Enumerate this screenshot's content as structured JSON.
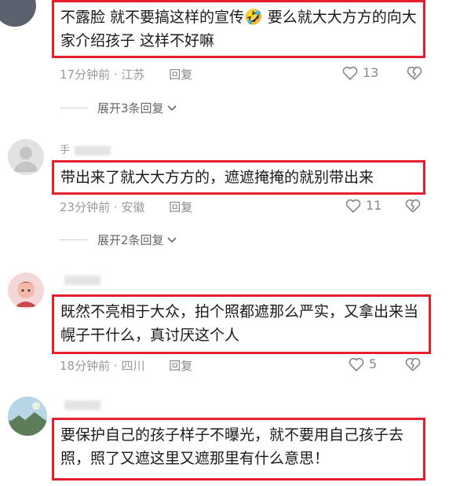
{
  "comments": [
    {
      "username": "",
      "text": "不露脸 就不要搞这样的宣传🤣 要么就大大方方的向大家介绍孩子 这样不好嘛",
      "time": "17分钟前",
      "location": "江苏",
      "reply_label": "回复",
      "likes": "13",
      "expand_label": "展开3条回复"
    },
    {
      "username": "手",
      "text": "带出来了就大大方方的，遮遮掩掩的就别带出来",
      "time": "23分钟前",
      "location": "安徽",
      "reply_label": "回复",
      "likes": "11",
      "expand_label": "展开2条回复"
    },
    {
      "username": "",
      "text": "既然不亮相于大众，拍个照都遮那么严实，又拿出来当幌子干什么，真讨厌这个人",
      "time": "18分钟前",
      "location": "四川",
      "reply_label": "回复",
      "likes": "5"
    },
    {
      "username": "",
      "text": "要保护自己的孩子样子不曝光，就不要用自己孩子去照，照了又遮这里又遮那里有什么意思！"
    }
  ],
  "meta_separator": "·",
  "colors": {
    "highlight_border": "#e5202e",
    "meta_text": "#999999"
  }
}
